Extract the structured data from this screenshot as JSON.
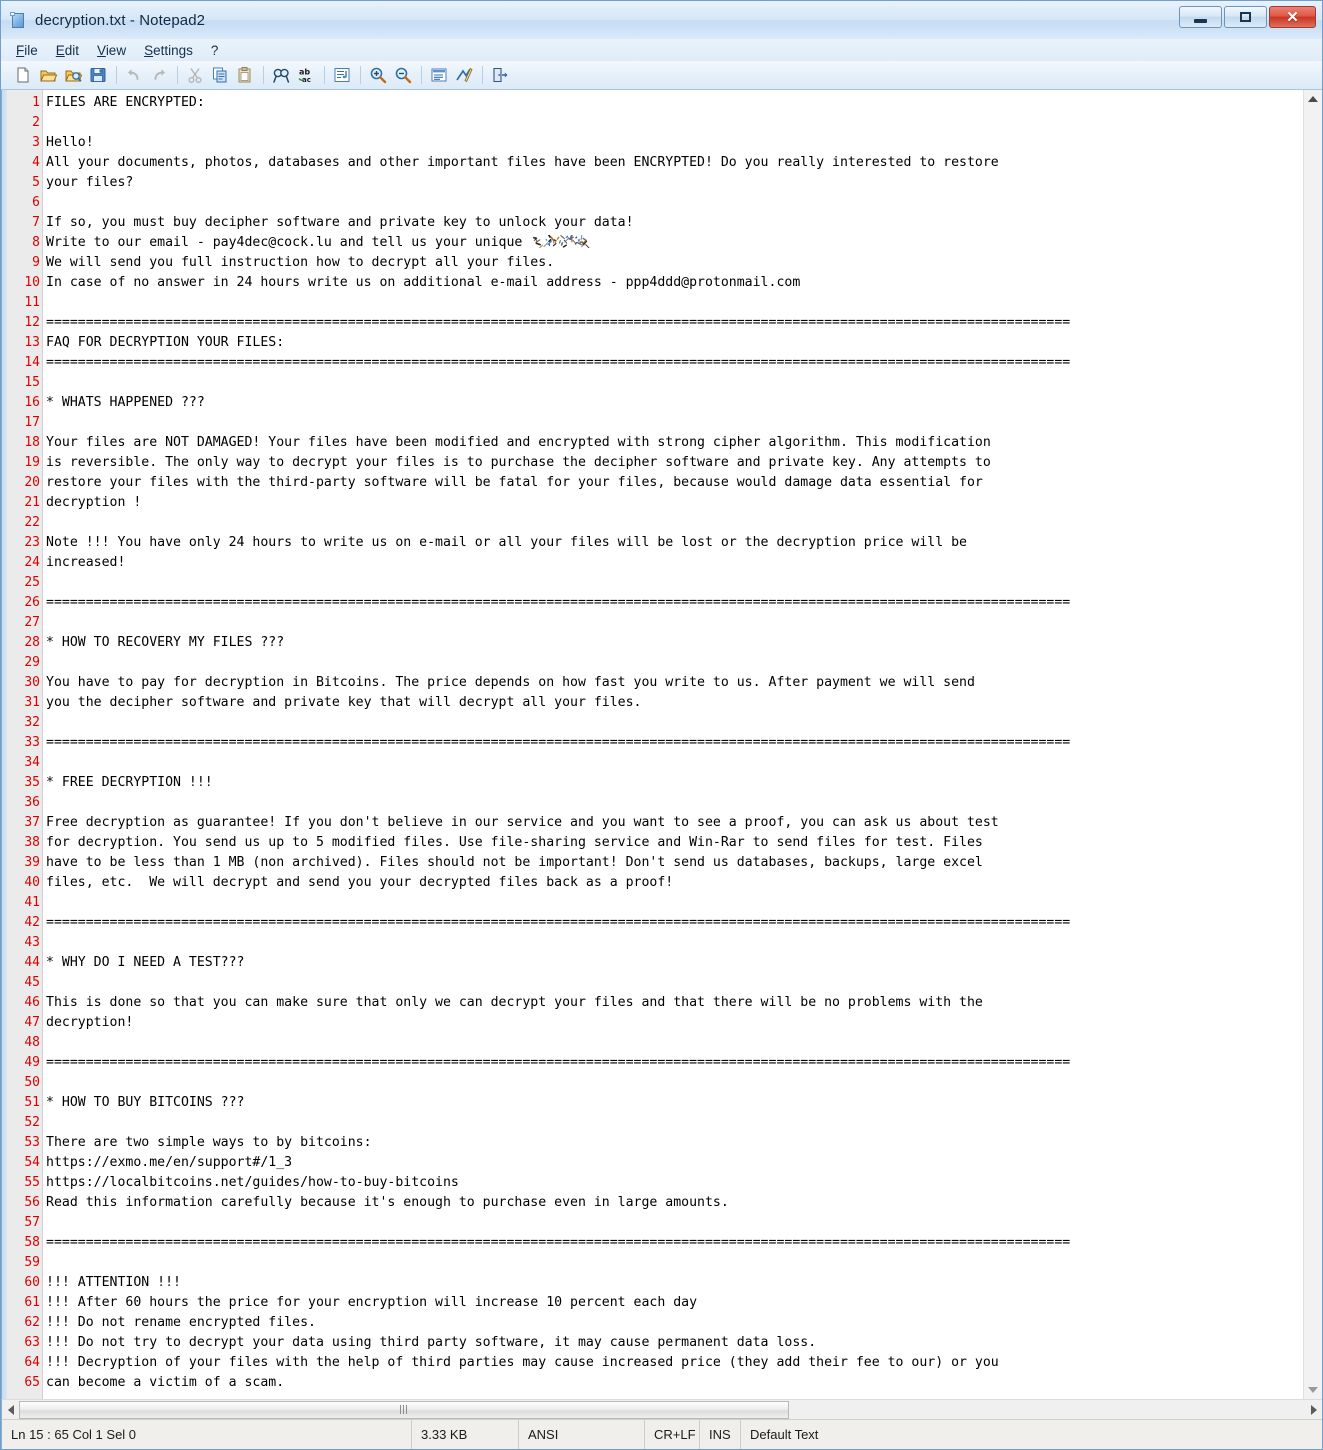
{
  "window": {
    "title": "decryption.txt - Notepad2",
    "icon": "notepad-document-icon",
    "controls": {
      "minimize": "minimize-button",
      "maximize": "maximize-button",
      "close": "close-button"
    }
  },
  "menubar": {
    "items": [
      {
        "label": "File",
        "accel": "F"
      },
      {
        "label": "Edit",
        "accel": "E"
      },
      {
        "label": "View",
        "accel": "V"
      },
      {
        "label": "Settings",
        "accel": "S"
      },
      {
        "label": "?",
        "accel": ""
      }
    ]
  },
  "toolbar": {
    "buttons": [
      {
        "name": "new-file-icon",
        "tip": "New"
      },
      {
        "name": "open-file-icon",
        "tip": "Open"
      },
      {
        "name": "browse-file-icon",
        "tip": "Browse"
      },
      {
        "name": "save-file-icon",
        "tip": "Save"
      },
      {
        "name": "separator",
        "tip": ""
      },
      {
        "name": "undo-icon",
        "tip": "Undo"
      },
      {
        "name": "redo-icon",
        "tip": "Redo"
      },
      {
        "name": "separator",
        "tip": ""
      },
      {
        "name": "cut-icon",
        "tip": "Cut"
      },
      {
        "name": "copy-icon",
        "tip": "Copy"
      },
      {
        "name": "paste-icon",
        "tip": "Paste"
      },
      {
        "name": "separator",
        "tip": ""
      },
      {
        "name": "find-icon",
        "tip": "Find"
      },
      {
        "name": "replace-icon",
        "tip": "Replace"
      },
      {
        "name": "separator",
        "tip": ""
      },
      {
        "name": "word-wrap-icon",
        "tip": "Word Wrap"
      },
      {
        "name": "separator",
        "tip": ""
      },
      {
        "name": "zoom-in-icon",
        "tip": "Zoom In"
      },
      {
        "name": "zoom-out-icon",
        "tip": "Zoom Out"
      },
      {
        "name": "separator",
        "tip": ""
      },
      {
        "name": "scheme-icon",
        "tip": "Scheme"
      },
      {
        "name": "scheme-options-icon",
        "tip": "Scheme Options"
      },
      {
        "name": "separator",
        "tip": ""
      },
      {
        "name": "exit-icon",
        "tip": "Exit"
      }
    ]
  },
  "editor": {
    "lines": [
      {
        "n": "1",
        "text": "FILES ARE ENCRYPTED:"
      },
      {
        "n": "2",
        "text": ""
      },
      {
        "n": "3",
        "text": "Hello!"
      },
      {
        "n": "4",
        "text": "All your documents, photos, databases and other important files have been ENCRYPTED! Do you really interested to restore"
      },
      {
        "n": "5",
        "text": "your files?"
      },
      {
        "n": "6",
        "text": ""
      },
      {
        "n": "7",
        "text": "If so, you must buy decipher software and private key to unlock your data!"
      },
      {
        "n": "8",
        "text": "Write to our email - pay4dec@cock.lu and tell us your unique ",
        "redacted": true
      },
      {
        "n": "9",
        "text": "We will send you full instruction how to decrypt all your files."
      },
      {
        "n": "10",
        "text": "In case of no answer in 24 hours write us on additional e-mail address - ppp4ddd@protonmail.com"
      },
      {
        "n": "11",
        "text": ""
      },
      {
        "n": "12",
        "text": "================================================================================================================================="
      },
      {
        "n": "13",
        "text": "FAQ FOR DECRYPTION YOUR FILES:"
      },
      {
        "n": "14",
        "text": "================================================================================================================================="
      },
      {
        "n": "15",
        "text": ""
      },
      {
        "n": "16",
        "text": "* WHATS HAPPENED ???"
      },
      {
        "n": "17",
        "text": ""
      },
      {
        "n": "18",
        "text": "Your files are NOT DAMAGED! Your files have been modified and encrypted with strong cipher algorithm. This modification"
      },
      {
        "n": "19",
        "text": "is reversible. The only way to decrypt your files is to purchase the decipher software and private key. Any attempts to"
      },
      {
        "n": "20",
        "text": "restore your files with the third-party software will be fatal for your files, because would damage data essential for"
      },
      {
        "n": "21",
        "text": "decryption !"
      },
      {
        "n": "22",
        "text": ""
      },
      {
        "n": "23",
        "text": "Note !!! You have only 24 hours to write us on e-mail or all your files will be lost or the decryption price will be"
      },
      {
        "n": "24",
        "text": "increased!"
      },
      {
        "n": "25",
        "text": ""
      },
      {
        "n": "26",
        "text": "================================================================================================================================="
      },
      {
        "n": "27",
        "text": ""
      },
      {
        "n": "28",
        "text": "* HOW TO RECOVERY MY FILES ???"
      },
      {
        "n": "29",
        "text": ""
      },
      {
        "n": "30",
        "text": "You have to pay for decryption in Bitcoins. The price depends on how fast you write to us. After payment we will send"
      },
      {
        "n": "31",
        "text": "you the decipher software and private key that will decrypt all your files."
      },
      {
        "n": "32",
        "text": ""
      },
      {
        "n": "33",
        "text": "================================================================================================================================="
      },
      {
        "n": "34",
        "text": ""
      },
      {
        "n": "35",
        "text": "* FREE DECRYPTION !!!"
      },
      {
        "n": "36",
        "text": ""
      },
      {
        "n": "37",
        "text": "Free decryption as guarantee! If you don't believe in our service and you want to see a proof, you can ask us about test"
      },
      {
        "n": "38",
        "text": "for decryption. You send us up to 5 modified files. Use file-sharing service and Win-Rar to send files for test. Files"
      },
      {
        "n": "39",
        "text": "have to be less than 1 MB (non archived). Files should not be important! Don't send us databases, backups, large excel"
      },
      {
        "n": "40",
        "text": "files, etc.  We will decrypt and send you your decrypted files back as a proof!"
      },
      {
        "n": "41",
        "text": ""
      },
      {
        "n": "42",
        "text": "================================================================================================================================="
      },
      {
        "n": "43",
        "text": ""
      },
      {
        "n": "44",
        "text": "* WHY DO I NEED A TEST???"
      },
      {
        "n": "45",
        "text": ""
      },
      {
        "n": "46",
        "text": "This is done so that you can make sure that only we can decrypt your files and that there will be no problems with the"
      },
      {
        "n": "47",
        "text": "decryption!"
      },
      {
        "n": "48",
        "text": ""
      },
      {
        "n": "49",
        "text": "================================================================================================================================="
      },
      {
        "n": "50",
        "text": ""
      },
      {
        "n": "51",
        "text": "* HOW TO BUY BITCOINS ???"
      },
      {
        "n": "52",
        "text": ""
      },
      {
        "n": "53",
        "text": "There are two simple ways to by bitcoins:"
      },
      {
        "n": "54",
        "text": "https://exmo.me/en/support#/1_3"
      },
      {
        "n": "55",
        "text": "https://localbitcoins.net/guides/how-to-buy-bitcoins"
      },
      {
        "n": "56",
        "text": "Read this information carefully because it's enough to purchase even in large amounts."
      },
      {
        "n": "57",
        "text": ""
      },
      {
        "n": "58",
        "text": "================================================================================================================================="
      },
      {
        "n": "59",
        "text": ""
      },
      {
        "n": "60",
        "text": "!!! ATTENTION !!!"
      },
      {
        "n": "61",
        "text": "!!! After 60 hours the price for your encryption will increase 10 percent each day"
      },
      {
        "n": "62",
        "text": "!!! Do not rename encrypted files."
      },
      {
        "n": "63",
        "text": "!!! Do not try to decrypt your data using third party software, it may cause permanent data loss."
      },
      {
        "n": "64",
        "text": "!!! Decryption of your files with the help of third parties may cause increased price (they add their fee to our) or you"
      },
      {
        "n": "65",
        "text": "can become a victim of a scam."
      }
    ]
  },
  "scrollbars": {
    "vertical": {
      "up_arrow": "scroll-up-arrow",
      "down_arrow": "scroll-down-arrow"
    },
    "horizontal": {
      "left_arrow": "scroll-left-arrow",
      "right_arrow": "scroll-right-arrow"
    }
  },
  "statusbar": {
    "position": "Ln 15 : 65   Col 1   Sel 0",
    "filesize": "3.33 KB",
    "encoding": "ANSI",
    "line_ending": "CR+LF",
    "insert_mode": "INS",
    "scheme": "Default Text"
  },
  "colors": {
    "line_number": "#dd0000",
    "gutter_bg": "#ebebeb",
    "text": "#000000",
    "title_text": "#132a44",
    "close_button": "#c93522"
  }
}
